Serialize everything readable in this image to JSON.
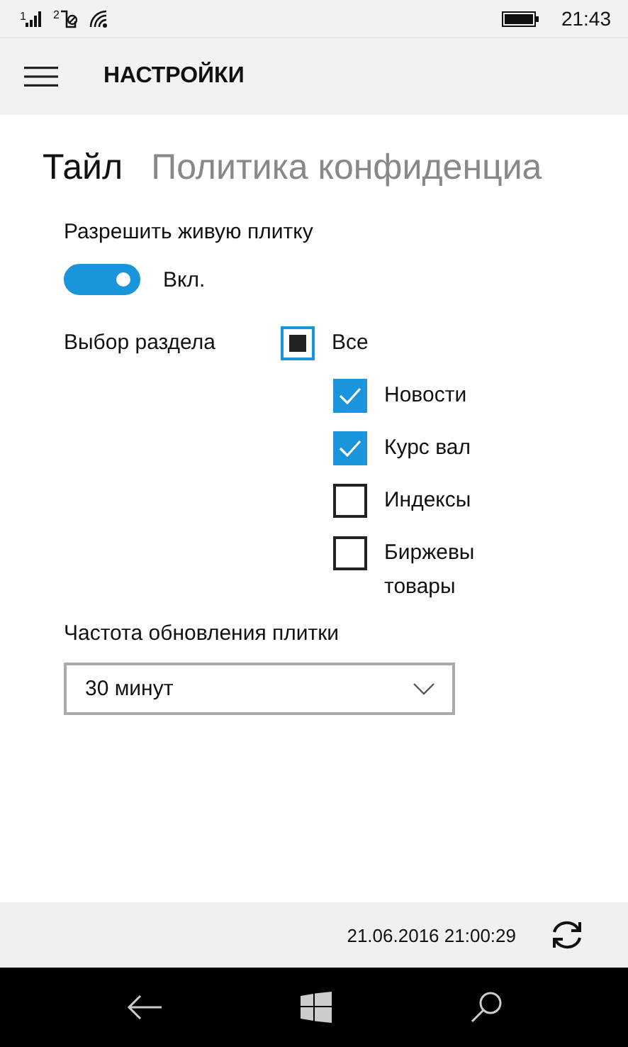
{
  "status_bar": {
    "signal_1_label": "1",
    "signal_2_label": "2",
    "time": "21:43"
  },
  "header": {
    "title": "НАСТРОЙКИ"
  },
  "tabs": [
    {
      "label": "Тайл",
      "selected": true
    },
    {
      "label": "Политика конфиденциа",
      "selected": false
    }
  ],
  "live_tile": {
    "label": "Разрешить живую плитку",
    "on": true,
    "state_text": "Вкл."
  },
  "sections": {
    "label": "Выбор раздела",
    "all": {
      "label": "Все",
      "indeterminate": true
    },
    "items": [
      {
        "label": "Новости",
        "checked": true
      },
      {
        "label": "Курс вал",
        "checked": true
      },
      {
        "label": "Индексы",
        "checked": false
      },
      {
        "label": "Биржевы\nтовары",
        "checked": false
      }
    ]
  },
  "update_frequency": {
    "label": "Частота обновления плитки",
    "value": "30 минут"
  },
  "footer": {
    "timestamp": "21.06.2016 21:00:29"
  }
}
